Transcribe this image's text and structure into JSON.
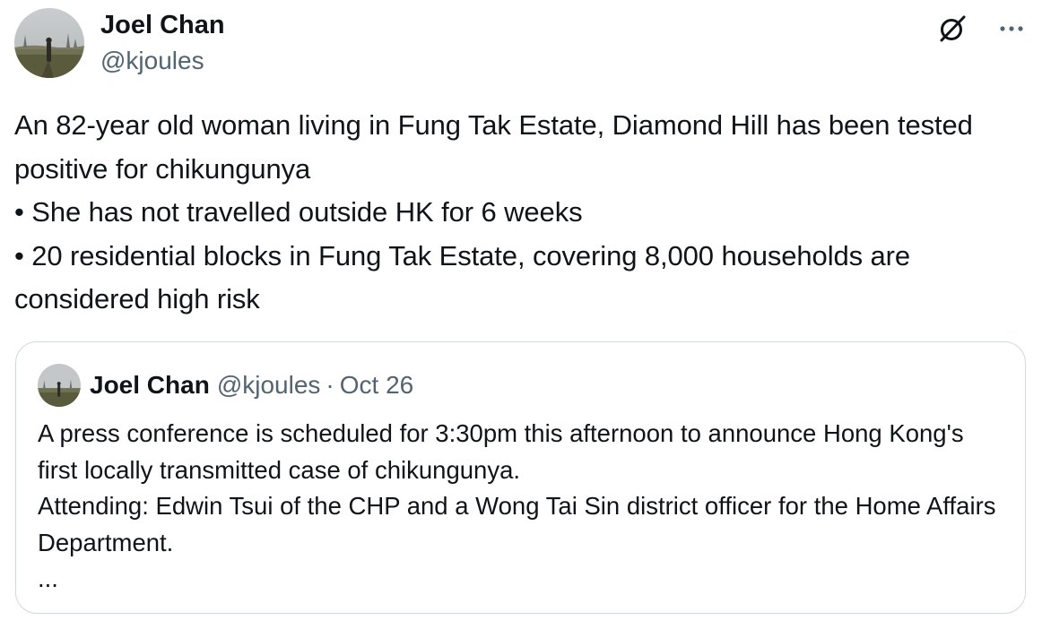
{
  "tweet": {
    "author": {
      "display_name": "Joel Chan",
      "handle": "@kjoules"
    },
    "icons": {
      "grok": "grok-icon",
      "more": "more-icon"
    },
    "lines": [
      "An 82-year old woman living in Fung Tak Estate, Diamond Hill has been tested positive for chikungunya",
      "• She has not travelled outside HK for 6 weeks",
      "• 20 residential blocks in Fung Tak Estate, covering 8,000 households are considered high risk"
    ]
  },
  "quote": {
    "display_name": "Joel Chan",
    "handle": "@kjoules",
    "separator": "·",
    "date": "Oct 26",
    "lines": [
      "A press conference is scheduled for 3:30pm this afternoon to announce Hong Kong's first locally transmitted case of chikungunya.",
      "Attending: Edwin Tsui of the CHP and a Wong Tai Sin district officer for the Home Affairs Department.",
      "..."
    ]
  },
  "colors": {
    "text_primary": "#0f1419",
    "text_secondary": "#536471",
    "border": "#cfd9de"
  }
}
